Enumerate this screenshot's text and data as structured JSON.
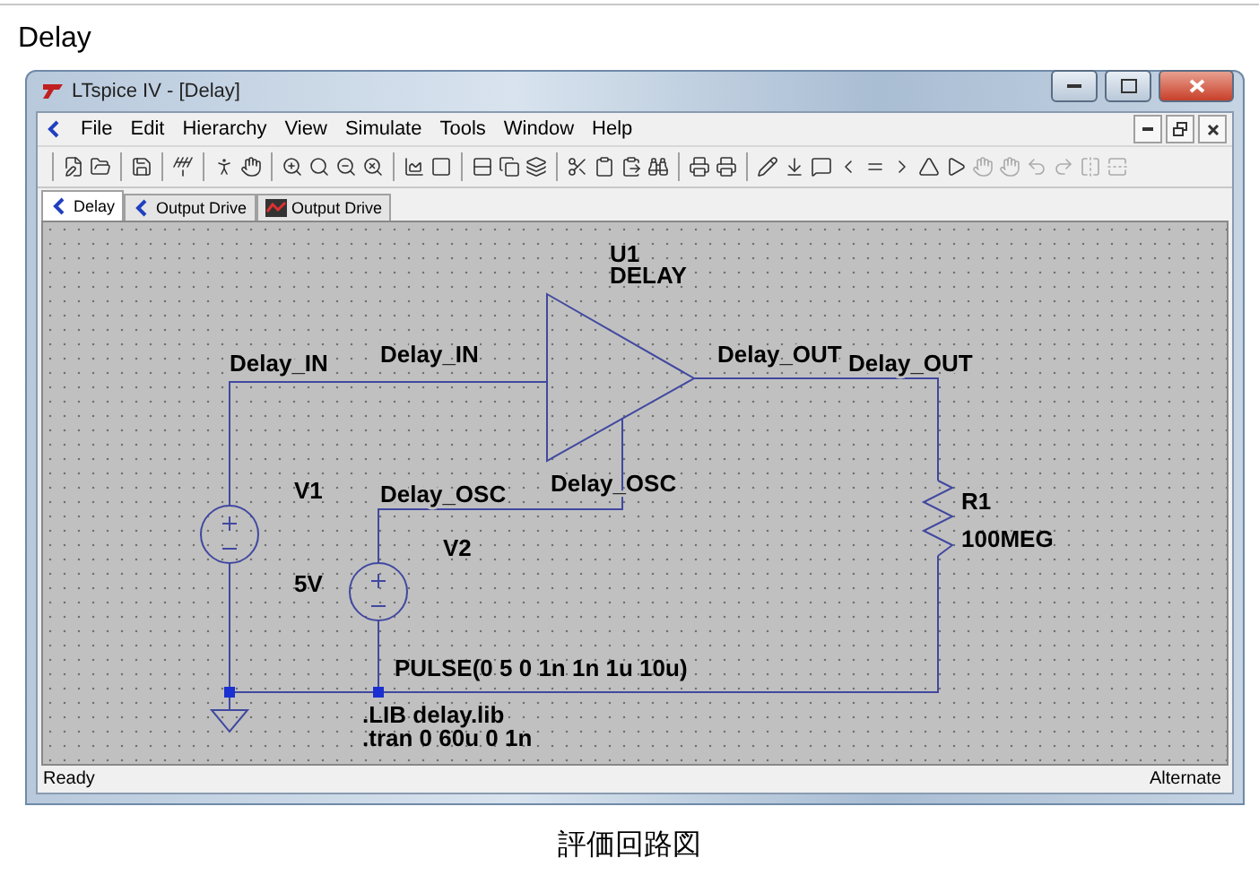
{
  "page_title": "Delay",
  "window": {
    "title": "LTspice IV - [Delay]"
  },
  "menu": [
    "File",
    "Edit",
    "Hierarchy",
    "View",
    "Simulate",
    "Tools",
    "Window",
    "Help"
  ],
  "tabs": [
    {
      "label": "Delay",
      "kind": "schematic",
      "selected": true
    },
    {
      "label": "Output Drive",
      "kind": "schematic",
      "selected": false
    },
    {
      "label": "Output Drive",
      "kind": "waveform",
      "selected": false
    }
  ],
  "schematic": {
    "component_labels": [
      "U1",
      "DELAY",
      "V1",
      "5V",
      "V2",
      "R1",
      "100MEG",
      "PULSE(0 5 0 1n 1n 1u 10u)"
    ],
    "net_labels": [
      "Delay_IN",
      "Delay_IN",
      "Delay_OUT",
      "Delay_OUT",
      "Delay_OSC",
      "Delay_OSC"
    ],
    "directives": [
      ".LIB delay.lib",
      ".tran 0 60u 0 1n"
    ]
  },
  "status_bar": {
    "left": "Ready",
    "right": "Alternate"
  },
  "caption": "評価回路図"
}
